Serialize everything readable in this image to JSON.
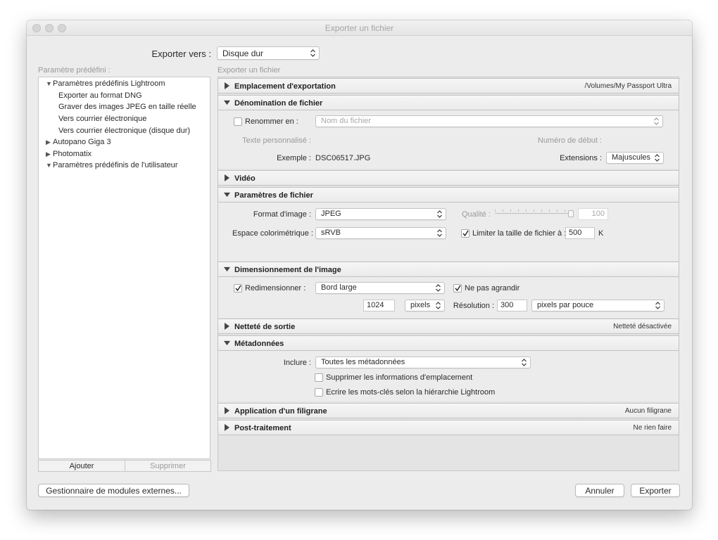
{
  "window": {
    "title": "Exporter un fichier"
  },
  "export_to": {
    "label": "Exporter vers :",
    "value": "Disque dur"
  },
  "presets": {
    "header": "Paramètre prédéfini :",
    "items": [
      {
        "label": "Paramètres prédéfinis Lightroom",
        "expanded": "▼"
      },
      {
        "label": "Exporter au format DNG"
      },
      {
        "label": "Graver des images JPEG en taille réelle"
      },
      {
        "label": "Vers courrier électronique"
      },
      {
        "label": "Vers courrier électronique (disque dur)"
      },
      {
        "label": "Autopano Giga 3",
        "expanded": "▶"
      },
      {
        "label": "Photomatix",
        "expanded": "▶"
      },
      {
        "label": "Paramètres prédéfinis de l'utilisateur",
        "expanded": "▼"
      }
    ],
    "add_label": "Ajouter",
    "remove_label": "Supprimer"
  },
  "right_header": "Exporter un fichier",
  "sections": {
    "location": {
      "title": "Emplacement d'exportation",
      "summary": "/Volumes/My Passport Ultra"
    },
    "naming": {
      "title": "Dénomination de fichier",
      "rename_label": "Renommer en :",
      "rename_value": "Nom du fichier",
      "custom_text_label": "Texte personnalisé :",
      "start_number_label": "Numéro de début :",
      "example_label": "Exemple :",
      "example_value": "DSC06517.JPG",
      "extensions_label": "Extensions :",
      "extensions_value": "Majuscules"
    },
    "video": {
      "title": "Vidéo"
    },
    "file_settings": {
      "title": "Paramètres de fichier",
      "format_label": "Format d'image :",
      "format_value": "JPEG",
      "quality_label": "Qualité :",
      "quality_value": "100",
      "colorspace_label": "Espace colorimétrique :",
      "colorspace_value": "sRVB",
      "limit_label": "Limiter la taille de fichier à :",
      "limit_value": "500",
      "limit_unit": "K"
    },
    "sizing": {
      "title": "Dimensionnement de l'image",
      "resize_label": "Redimensionner :",
      "resize_value": "Bord large",
      "no_enlarge_label": "Ne pas agrandir",
      "size_value": "1024",
      "size_unit": "pixels",
      "resolution_label": "Résolution :",
      "resolution_value": "300",
      "resolution_unit": "pixels par pouce"
    },
    "sharpening": {
      "title": "Netteté de sortie",
      "summary": "Netteté désactivée"
    },
    "metadata": {
      "title": "Métadonnées",
      "include_label": "Inclure :",
      "include_value": "Toutes les métadonnées",
      "remove_location_label": "Supprimer les informations d'emplacement",
      "hierarchy_label": "Ecrire les mots-clés selon la hiérarchie Lightroom"
    },
    "watermark": {
      "title": "Application d'un filigrane",
      "summary": "Aucun filigrane"
    },
    "post": {
      "title": "Post-traitement",
      "summary": "Ne rien faire"
    }
  },
  "footer": {
    "plugin_manager_label": "Gestionnaire de modules externes...",
    "cancel_label": "Annuler",
    "export_label": "Exporter"
  }
}
